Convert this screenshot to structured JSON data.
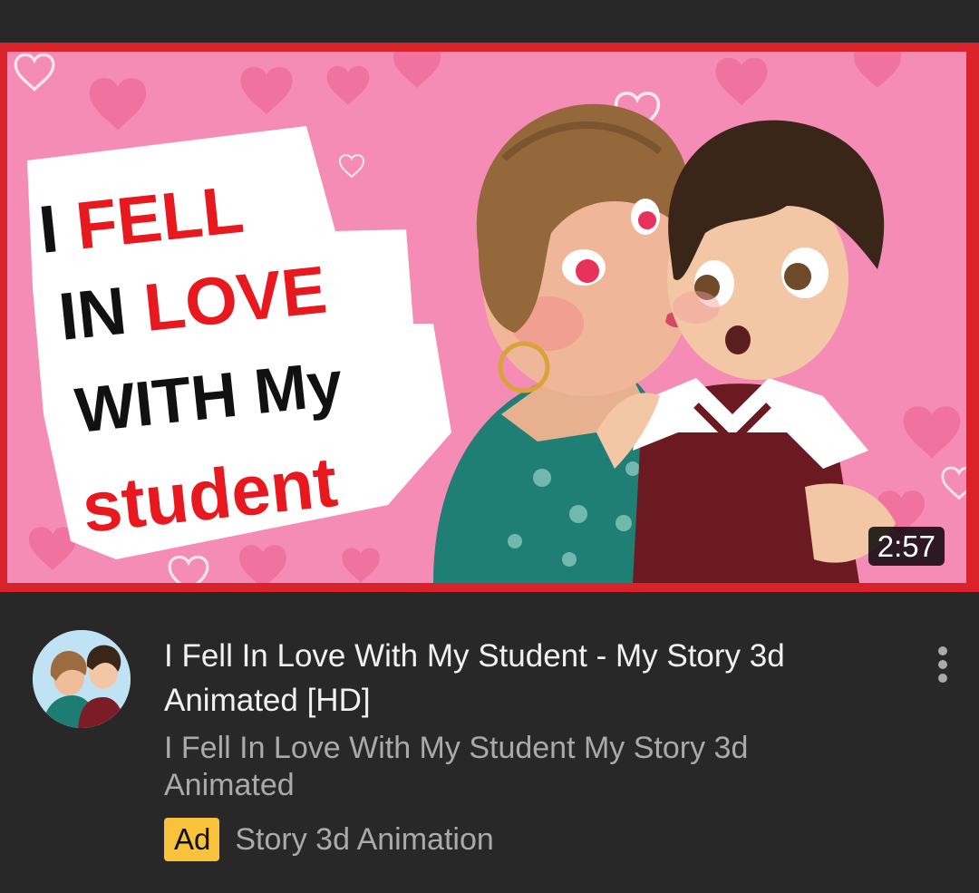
{
  "video": {
    "thumbnail_text_line1_a": "I ",
    "thumbnail_text_line1_b": "FELL",
    "thumbnail_text_line2_a": "IN ",
    "thumbnail_text_line2_b": "LOVE",
    "thumbnail_text_line3": "WITH My",
    "thumbnail_text_line4": "student",
    "duration": "2:57",
    "title": "I Fell In Love With My Student - My Story 3d Animated [HD]",
    "description": "I Fell In Love With My Student My Story 3d Animated",
    "ad_badge": "Ad",
    "channel": "Story 3d Animation"
  },
  "icons": {
    "more": "more-vertical-icon"
  },
  "colors": {
    "background": "#282828",
    "thumbnail_border": "#d9222a",
    "thumbnail_pink": "#f58cb6",
    "ad_badge": "#f8c33a",
    "title_text": "#f1f1f1",
    "secondary_text": "#aaaaaa"
  }
}
